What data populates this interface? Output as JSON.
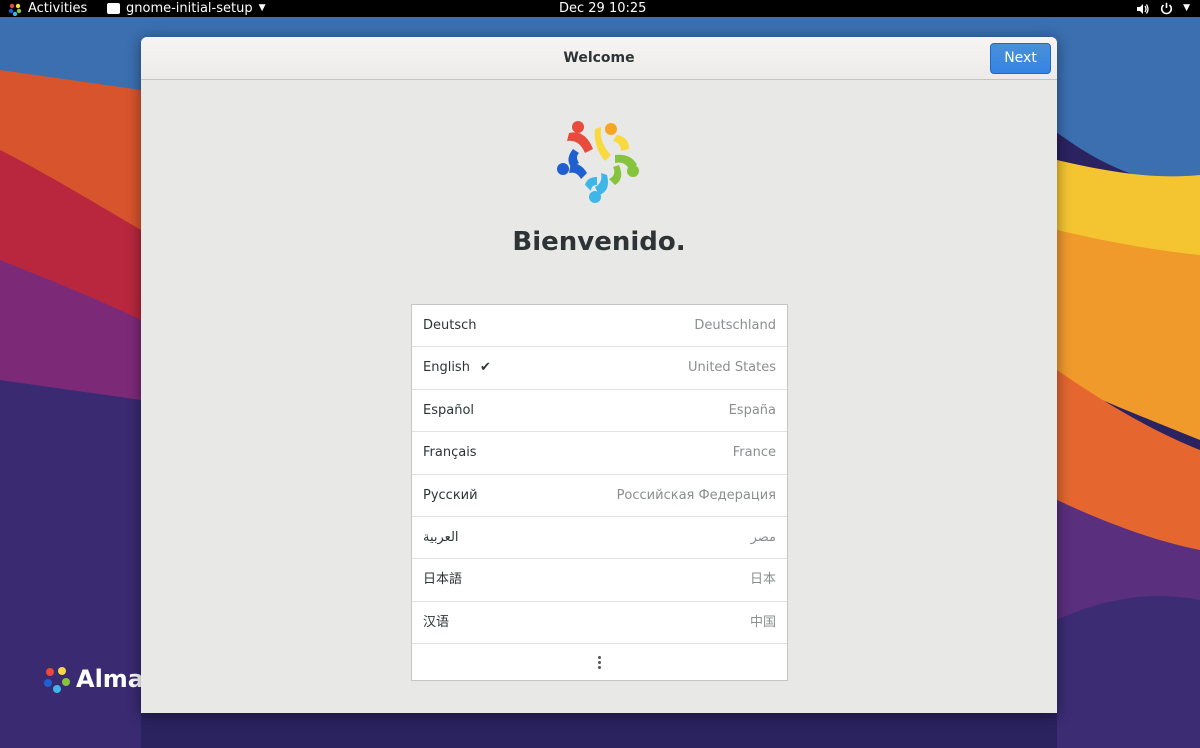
{
  "topbar": {
    "activities_label": "Activities",
    "app_menu_label": "gnome-initial-setup",
    "clock": "Dec 29  10:25"
  },
  "desktop": {
    "logo_text": "AlmaL"
  },
  "window": {
    "title": "Welcome",
    "next_label": "Next",
    "heading": "Bienvenido."
  },
  "languages": [
    {
      "language": "Deutsch",
      "region": "Deutschland",
      "selected": false
    },
    {
      "language": "English",
      "region": "United States",
      "selected": true
    },
    {
      "language": "Español",
      "region": "España",
      "selected": false
    },
    {
      "language": "Français",
      "region": "France",
      "selected": false
    },
    {
      "language": "Русский",
      "region": "Российская Федерация",
      "selected": false
    },
    {
      "language": "العربية",
      "region": "مصر",
      "selected": false
    },
    {
      "language": "日本語",
      "region": "日本",
      "selected": false
    },
    {
      "language": "汉语",
      "region": "中国",
      "selected": false
    }
  ],
  "icons": {
    "check": "check-icon",
    "more": "more-icon",
    "volume": "volume-icon",
    "power": "power-icon"
  },
  "colors": {
    "accent": "#3584e4",
    "logo_red": "#e84b3c",
    "logo_orange": "#f6a624",
    "logo_yellow": "#f8d93f",
    "logo_green": "#86c43c",
    "logo_cyan": "#3fb6e8",
    "logo_blue": "#1f5fd0"
  }
}
